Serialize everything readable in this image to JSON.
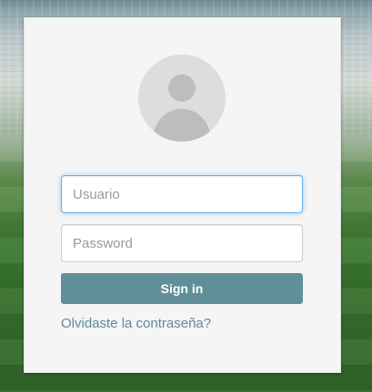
{
  "colors": {
    "button_bg": "#608f99",
    "link": "#5f8b9a",
    "card_bg": "#f5f5f5",
    "focus_border": "#66afe9"
  },
  "avatar": {
    "icon": "user-avatar-icon"
  },
  "login": {
    "username_placeholder": "Usuario",
    "password_placeholder": "Password",
    "sign_in_label": "Sign in",
    "forgot_link": "Olvidaste la contraseña?"
  }
}
